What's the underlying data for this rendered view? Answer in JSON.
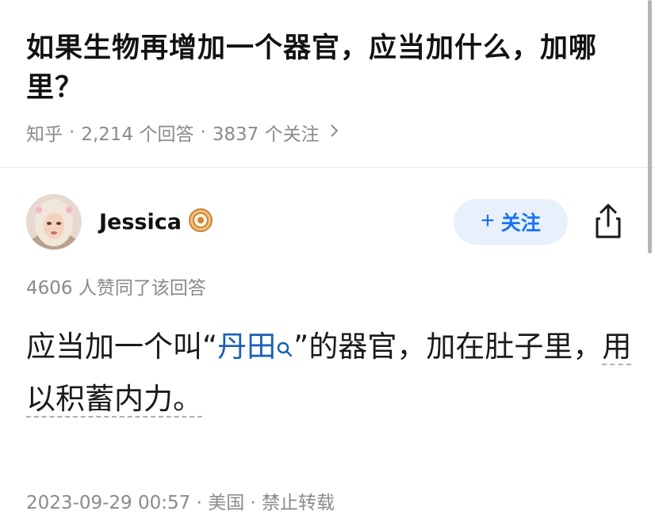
{
  "question": {
    "title": "如果生物再增加一个器官，应当加什么，加哪里？",
    "meta": {
      "source": "知乎",
      "sep1": "·",
      "answers": "2,214 个回答",
      "sep2": "·",
      "followers": "3837 个关注"
    }
  },
  "author": {
    "name": "Jessica",
    "follow_label": "关注"
  },
  "answer": {
    "upvotes": "4606 人赞同了该回答",
    "text_before": "应当加一个叫“",
    "link_text": "丹田",
    "text_middle": "”的器官，加在肚子里，",
    "text_dashed": "用以积蓄内力。",
    "footer": "2023-09-29 00:57 · 美国 · 禁止转载"
  },
  "colors": {
    "accent": "#1772f6",
    "follow_bg": "#e8f0fb",
    "link": "#1a5fb4",
    "meta_gray": "#8a8a8a"
  },
  "icons": [
    "chevron-right-icon",
    "verified-badge-icon",
    "plus-icon",
    "share-icon",
    "search-icon"
  ]
}
